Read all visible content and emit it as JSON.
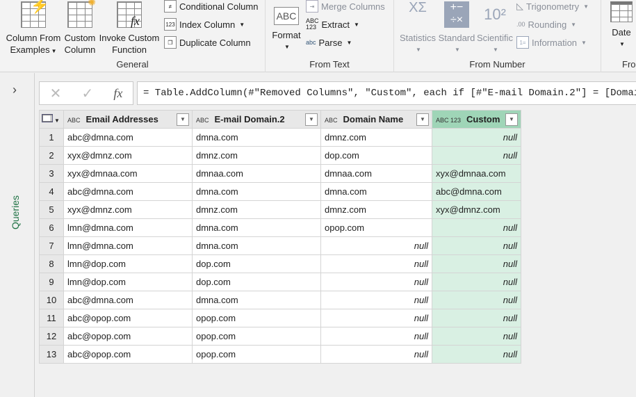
{
  "ribbon": {
    "general": {
      "label": "General",
      "column_from_examples": [
        "Column From",
        "Examples"
      ],
      "custom_column": [
        "Custom",
        "Column"
      ],
      "invoke_custom_function": [
        "Invoke Custom",
        "Function"
      ],
      "conditional_column": "Conditional Column",
      "index_column": "Index Column",
      "duplicate_column": "Duplicate Column"
    },
    "from_text": {
      "label": "From Text",
      "format": "Format",
      "merge_columns": "Merge Columns",
      "extract": "Extract",
      "parse": "Parse"
    },
    "from_number": {
      "label": "From Number",
      "statistics": "Statistics",
      "standard": "Standard",
      "scientific": "Scientific",
      "trigonometry": "Trigonometry",
      "rounding": "Rounding",
      "information": "Information"
    },
    "from_date": {
      "label": "Fro",
      "date": "Date"
    }
  },
  "queries_label": "Queries",
  "formula": "= Table.AddColumn(#\"Removed Columns\", \"Custom\", each if [#\"E-mail Domain.2\"] = [Domain",
  "table": {
    "columns": [
      {
        "type": "ABC",
        "name": "Email Addresses"
      },
      {
        "type": "ABC",
        "name": "E-mail Domain.2"
      },
      {
        "type": "ABC",
        "name": "Domain Name"
      },
      {
        "type": "ABC 123",
        "name": "Custom"
      }
    ],
    "rows": [
      [
        "1",
        "abc@dmna.com",
        "dmna.com",
        "dmnz.com",
        "null"
      ],
      [
        "2",
        "xyx@dmnz.com",
        "dmnz.com",
        "dop.com",
        "null"
      ],
      [
        "3",
        "xyx@dmnaa.com",
        "dmnaa.com",
        "dmnaa.com",
        "xyx@dmnaa.com"
      ],
      [
        "4",
        "abc@dmna.com",
        "dmna.com",
        "dmna.com",
        "abc@dmna.com"
      ],
      [
        "5",
        "xyx@dmnz.com",
        "dmnz.com",
        "dmnz.com",
        "xyx@dmnz.com"
      ],
      [
        "6",
        "lmn@dmna.com",
        "dmna.com",
        "opop.com",
        "null"
      ],
      [
        "7",
        "lmn@dmna.com",
        "dmna.com",
        "null",
        "null"
      ],
      [
        "8",
        "lmn@dop.com",
        "dop.com",
        "null",
        "null"
      ],
      [
        "9",
        "lmn@dop.com",
        "dop.com",
        "null",
        "null"
      ],
      [
        "10",
        "abc@dmna.com",
        "dmna.com",
        "null",
        "null"
      ],
      [
        "11",
        "abc@opop.com",
        "opop.com",
        "null",
        "null"
      ],
      [
        "12",
        "abc@opop.com",
        "opop.com",
        "null",
        "null"
      ],
      [
        "13",
        "abc@opop.com",
        "opop.com",
        "null",
        "null"
      ]
    ]
  },
  "colors": {
    "accent": "#217346",
    "custom_header": "#9fd5b7",
    "custom_cell": "#d9f0e3"
  }
}
